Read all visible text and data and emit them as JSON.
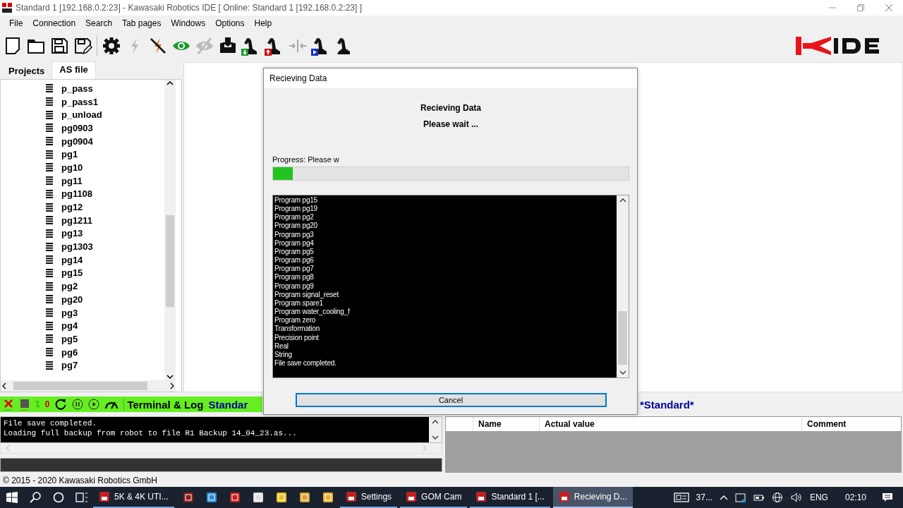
{
  "window": {
    "title": "Standard 1 [192.168.0.2:23] - Kawasaki Robotics IDE [ Online: Standard 1 [192.168.0.2:23] ]"
  },
  "menu": [
    "File",
    "Connection",
    "Search",
    "Tab pages",
    "Windows",
    "Options",
    "Help"
  ],
  "sidebar": {
    "tabs": [
      {
        "label": "Projects",
        "selected": false
      },
      {
        "label": "AS file",
        "selected": true
      }
    ],
    "items": [
      "p_pass",
      "p_pass1",
      "p_unload",
      "pg0903",
      "pg0904",
      "pg1",
      "pg10",
      "pg11",
      "pg1108",
      "pg12",
      "pg1211",
      "pg13",
      "pg1303",
      "pg14",
      "pg15",
      "pg2",
      "pg20",
      "pg3",
      "pg4",
      "pg5",
      "pg6",
      "pg7"
    ]
  },
  "status_bar": {
    "ok_count": "1",
    "error_count": "0",
    "title": "Terminal & Log",
    "robot": "Standar",
    "project": "*Standard*"
  },
  "terminal": {
    "lines": [
      "File save completed.",
      "Loading full backup from robot to file R1 Backup 14_04_23.as..."
    ]
  },
  "variables_table": {
    "columns": [
      "Name",
      "Actual value",
      "Comment"
    ]
  },
  "footer": "© 2015 - 2020 Kawasaki Robotics GmbH",
  "dialog": {
    "title": "Recieving Data",
    "heading": "Recieving Data",
    "message": "Please wait ...",
    "progress": {
      "label": "Progress: Please w",
      "level": 0.055
    },
    "log": [
      "Program pg15",
      "Program pg19",
      "Program pg2",
      "Program pg20",
      "Program pg3",
      "Program pg4",
      "Program pg5",
      "Program pg6",
      "Program pg7",
      "Program pg8",
      "Program pg9",
      "Program signal_reset",
      "Program spare1",
      "Program water_cooling_f",
      "Program zero",
      "Transformation",
      "Precision point",
      "Real",
      "String",
      "File save completed."
    ],
    "buttons": [
      "Cancel"
    ]
  },
  "taskbar": {
    "items": [
      {
        "kind": "window",
        "label": "5K & 4K UTI...",
        "selected": false
      },
      {
        "kind": "pinned"
      },
      {
        "kind": "pinned"
      },
      {
        "kind": "pinned"
      },
      {
        "kind": "pinned"
      },
      {
        "kind": "pinned"
      },
      {
        "kind": "pinned"
      },
      {
        "kind": "pinned"
      },
      {
        "kind": "window",
        "label": "Settings",
        "selected": false
      },
      {
        "kind": "window",
        "label": "GOM Cam",
        "selected": false
      },
      {
        "kind": "window",
        "label": "Standard 1 [...",
        "selected": false
      },
      {
        "kind": "window",
        "label": "Recieving D...",
        "selected": true
      }
    ],
    "weather": "37...",
    "language": "ENG",
    "time": "02:10"
  }
}
